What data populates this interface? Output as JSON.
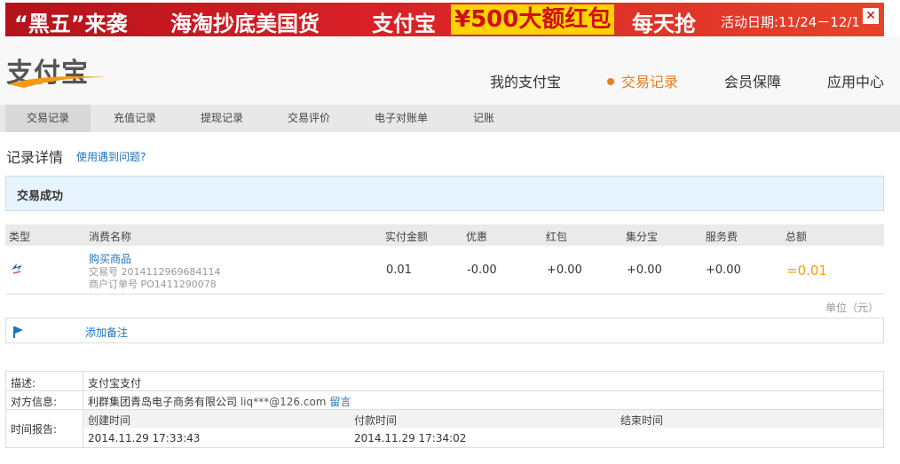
{
  "banner": {
    "part1": "“黑五”来袭",
    "part2": "海淘抄底美国货",
    "part3": "支付宝",
    "amount": "¥500大额红包",
    "part4": "每天抢",
    "date": "活动日期:11/24－12/1",
    "close": "✕"
  },
  "header": {
    "logo": "支付宝",
    "nav": [
      {
        "label": "我的支付宝"
      },
      {
        "label": "交易记录",
        "active": true
      },
      {
        "label": "会员保障"
      },
      {
        "label": "应用中心"
      }
    ]
  },
  "subnav": [
    "交易记录",
    "充值记录",
    "提现记录",
    "交易评价",
    "电子对账单",
    "记账"
  ],
  "page": {
    "title": "记录详情",
    "help": "使用遇到问题?",
    "status": "交易成功"
  },
  "table": {
    "headers": [
      "类型",
      "消费名称",
      "实付金额",
      "优惠",
      "红包",
      "集分宝",
      "服务费",
      "总额"
    ],
    "row": {
      "icon": "transfer-icon",
      "name": "购买商品",
      "trade_no": "交易号 2014112969684114",
      "order_no": "商户订单号 PO1411290078",
      "paid": "0.01",
      "discount": "-0.00",
      "red_packet": "+0.00",
      "points": "+0.00",
      "fee": "+0.00",
      "total": "=0.01"
    },
    "unit": "单位（元）"
  },
  "memo": {
    "icon": "flag-icon",
    "add": "添加备注"
  },
  "detail": {
    "desc_label": "描述:",
    "desc_value": "支付宝支付",
    "party_label": "对方信息:",
    "party_name": "利群集团青岛电子商务有限公司",
    "party_email": "liq***@126.com",
    "party_msg": "留言",
    "time_label": "时间报告:",
    "time_headers": [
      "创建时间",
      "付款时间",
      "结束时间"
    ],
    "time_values": [
      "2014.11.29 17:33:43",
      "2014.11.29 17:34:02",
      ""
    ]
  },
  "colors": {
    "accent": "#e67e22",
    "link": "#1e73be",
    "banner_red": "#d81f26",
    "banner_yellow": "#ffd400",
    "status_bg": "#e8f4fd"
  }
}
